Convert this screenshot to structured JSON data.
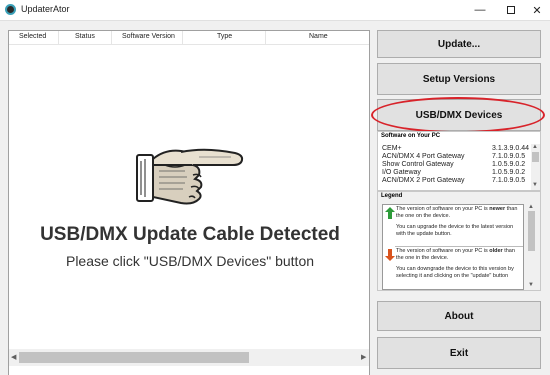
{
  "window": {
    "title": "UpdaterAtor",
    "min_glyph": "—",
    "close_glyph": "✕"
  },
  "device_list": {
    "columns": [
      "Selected",
      "Status",
      "Software Version",
      "Type",
      "Name"
    ],
    "message_title": "USB/DMX Update Cable Detected",
    "message_sub": "Please click \"USB/DMX Devices\" button"
  },
  "buttons": {
    "update": "Update...",
    "setup_versions": "Setup Versions",
    "usb_dmx_devices": "USB/DMX Devices",
    "about": "About",
    "exit": "Exit"
  },
  "software_panel": {
    "title": "Software on Your PC",
    "rows": [
      {
        "name": "CEM+",
        "version": "3.1.3.9.0.44"
      },
      {
        "name": "ACN/DMX 4 Port Gateway",
        "version": "7.1.0.9.0.5"
      },
      {
        "name": "Show Control Gateway",
        "version": "1.0.5.9.0.2"
      },
      {
        "name": "I/O Gateway",
        "version": "1.0.5.9.0.2"
      },
      {
        "name": "ACN/DMX 2 Port Gateway",
        "version": "7.1.0.9.0.5"
      }
    ]
  },
  "legend": {
    "title": "Legend",
    "newer": {
      "line1_before": "The version of software on your PC is ",
      "line1_bold": "newer",
      "line1_after": " than the one on the device.",
      "line2": "You can upgrade the device to the latest version with the update button."
    },
    "older": {
      "line1_before": "The version of software on your PC is ",
      "line1_bold": "older",
      "line1_after": " than the one in the device.",
      "line2": "You can downgrade the device to this version by selecting it and clicking on the \"update\" button"
    }
  },
  "scroll_arrows": {
    "left": "◀",
    "right": "▶",
    "up": "▲",
    "down": "▼"
  },
  "colors": {
    "highlight_ring": "#d8232a",
    "arrow_up": "#2e9b3a",
    "arrow_down": "#d9531e"
  }
}
